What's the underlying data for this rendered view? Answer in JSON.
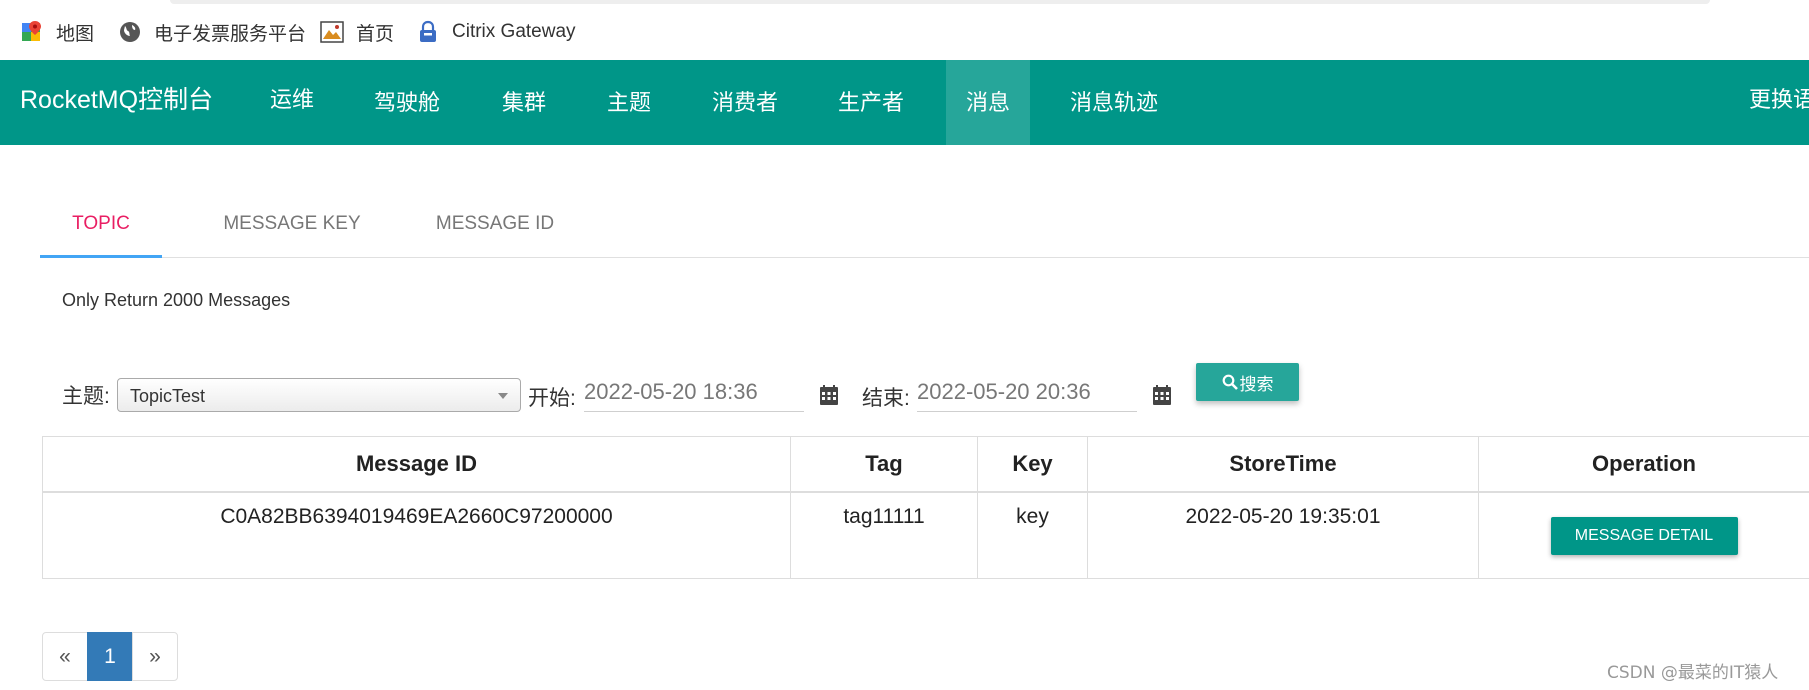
{
  "bookmarks": [
    {
      "label": "地图",
      "icon": "maps-icon"
    },
    {
      "label": "电子发票服务平台",
      "icon": "globe-icon"
    },
    {
      "label": "首页",
      "icon": "image-icon"
    },
    {
      "label": "Citrix Gateway",
      "icon": "lock-icon"
    }
  ],
  "navbar": {
    "brand": "RocketMQ控制台",
    "items": [
      "运维",
      "驾驶舱",
      "集群",
      "主题",
      "消费者",
      "生产者",
      "消息",
      "消息轨迹"
    ],
    "active_item": "消息",
    "lang": "更换语言",
    "color": "#009688"
  },
  "tabs": {
    "items": [
      "TOPIC",
      "MESSAGE KEY",
      "MESSAGE ID"
    ],
    "active": "TOPIC"
  },
  "note": "Only Return 2000 Messages",
  "search": {
    "topic_label": "主题:",
    "topic_value": "TopicTest",
    "start_label": "开始:",
    "start_value": "2022-05-20 18:36",
    "end_label": "结束:",
    "end_value": "2022-05-20 20:36",
    "button_label": "搜索"
  },
  "table": {
    "columns": [
      "Message ID",
      "Tag",
      "Key",
      "StoreTime",
      "Operation"
    ],
    "rows": [
      {
        "message_id": "C0A82BB6394019469EA2660C97200000",
        "tag": "tag11111",
        "key": "key",
        "store_time": "2022-05-20 19:35:01",
        "action": "MESSAGE DETAIL"
      }
    ]
  },
  "pagination": {
    "prev": "«",
    "current": "1",
    "next": "»"
  },
  "watermark": "CSDN @最菜的IT猿人"
}
